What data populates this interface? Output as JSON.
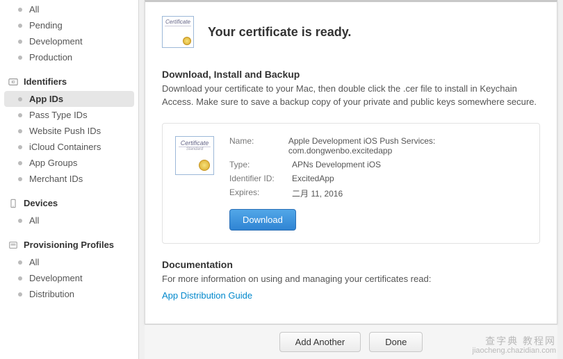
{
  "sidebar": {
    "certificates": {
      "items": [
        {
          "label": "All"
        },
        {
          "label": "Pending"
        },
        {
          "label": "Development"
        },
        {
          "label": "Production"
        }
      ]
    },
    "identifiers": {
      "header": "Identifiers",
      "items": [
        {
          "label": "App IDs",
          "selected": true
        },
        {
          "label": "Pass Type IDs"
        },
        {
          "label": "Website Push IDs"
        },
        {
          "label": "iCloud Containers"
        },
        {
          "label": "App Groups"
        },
        {
          "label": "Merchant IDs"
        }
      ]
    },
    "devices": {
      "header": "Devices",
      "items": [
        {
          "label": "All"
        }
      ]
    },
    "profiles": {
      "header": "Provisioning Profiles",
      "items": [
        {
          "label": "All"
        },
        {
          "label": "Development"
        },
        {
          "label": "Distribution"
        }
      ]
    }
  },
  "main": {
    "title": "Your certificate is ready.",
    "cert_icon_title": "Certificate",
    "cert_icon_sub": "Standard",
    "download_section": {
      "heading": "Download, Install and Backup",
      "body": "Download your certificate to your Mac, then double click the .cer file to install in Keychain Access. Make sure to save a backup copy of your private and public keys somewhere secure."
    },
    "info": {
      "name_label": "Name:",
      "name_value": "Apple Development iOS Push Services: com.dongwenbo.excitedapp",
      "type_label": "Type:",
      "type_value": "APNs Development iOS",
      "identifier_label": "Identifier ID:",
      "identifier_value": "ExcitedApp",
      "expires_label": "Expires:",
      "expires_value": "二月 11, 2016",
      "download_btn": "Download"
    },
    "docs": {
      "heading": "Documentation",
      "body": "For more information on using and managing your certificates read:",
      "link": "App Distribution Guide"
    }
  },
  "footer": {
    "add_another": "Add Another",
    "done": "Done"
  },
  "watermark": {
    "cn": "查字典 教程网",
    "url": "jiaocheng.chazidian.com"
  }
}
